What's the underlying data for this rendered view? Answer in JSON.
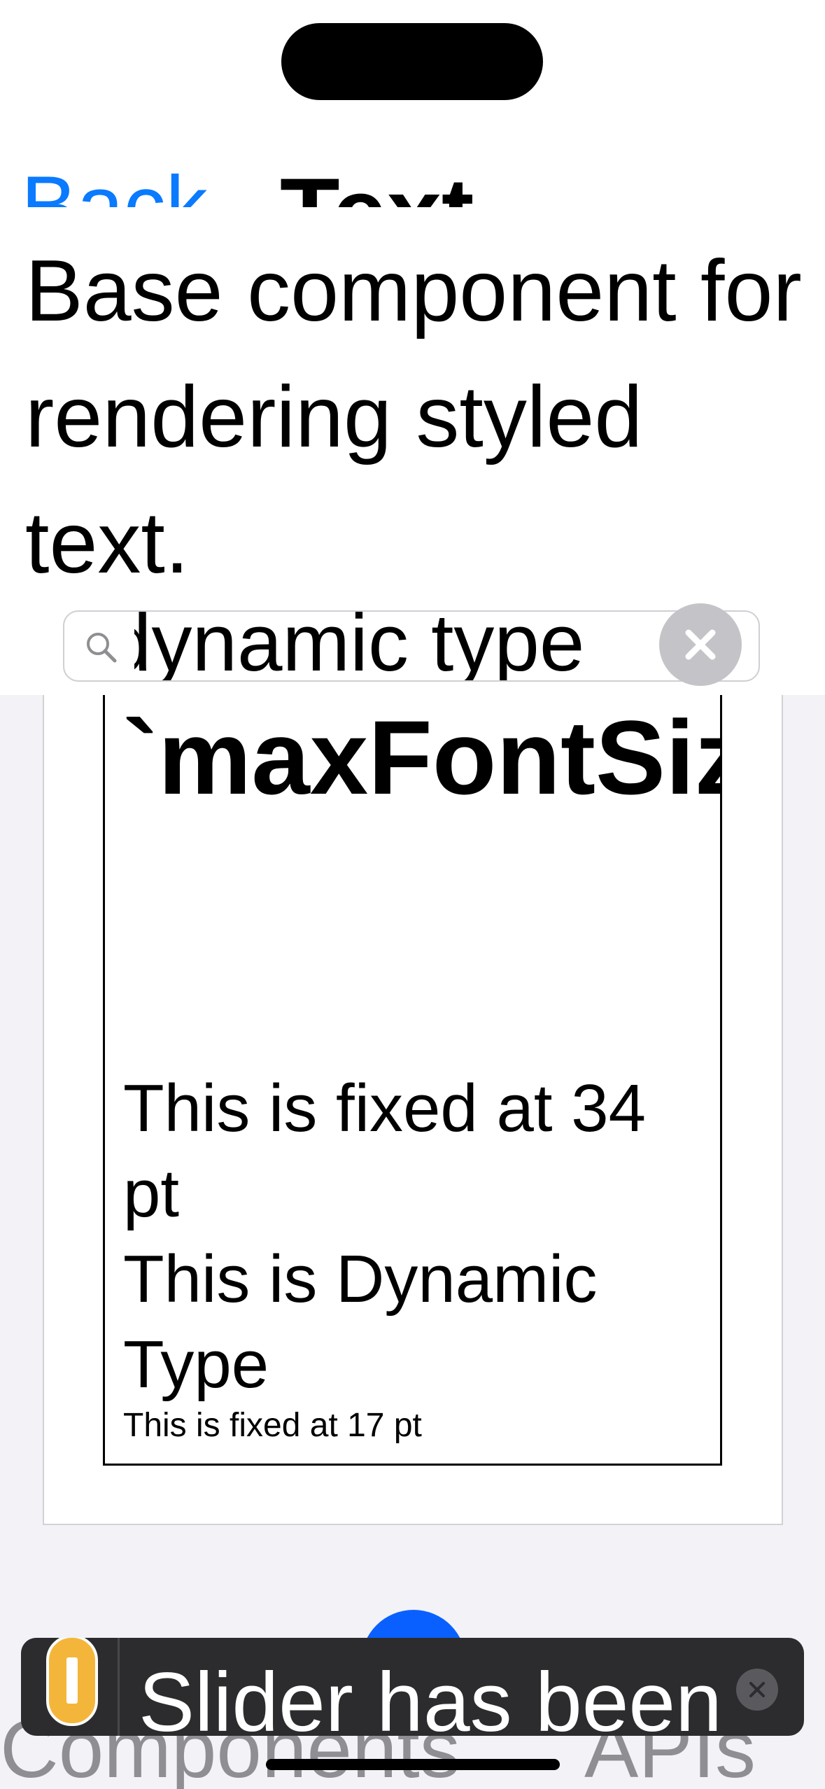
{
  "nav": {
    "back_label": "Back",
    "title": "Text"
  },
  "description": "Base component for rendering styled text.",
  "search": {
    "value": "dynamic type",
    "placeholder": ""
  },
  "example": {
    "heading": "`maxFontSizeMultiplier`:",
    "line_fixed_34": "This is fixed at 34 pt",
    "line_dynamic": "This is Dynamic Type",
    "line_fixed_17": "This is fixed at 17 pt"
  },
  "tabs": {
    "components": "Components",
    "apis": "APIs"
  },
  "toast": {
    "message": "Slider has been"
  },
  "colors": {
    "accent": "#0a7aff",
    "toast_bg": "#2c2c2e",
    "warning": "#f4b63a"
  }
}
